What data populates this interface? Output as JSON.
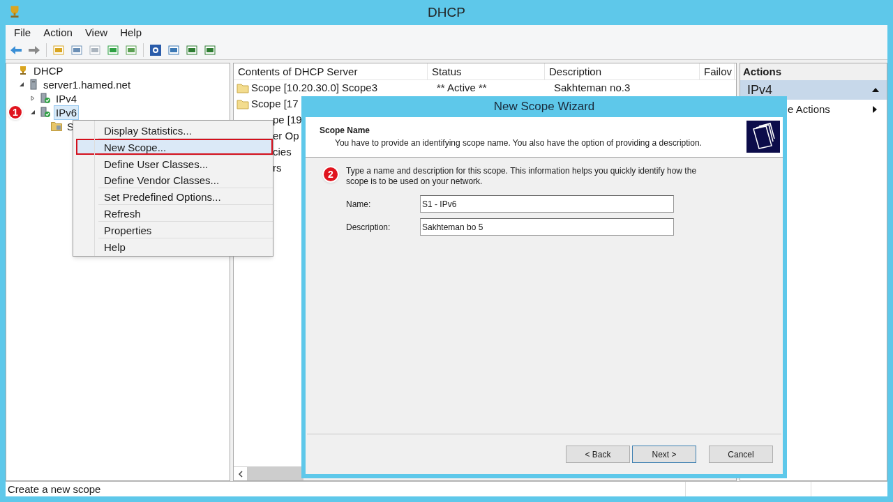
{
  "window": {
    "title": "DHCP"
  },
  "menu": [
    "File",
    "Action",
    "View",
    "Help"
  ],
  "tree": [
    {
      "label": "DHCP",
      "kind": "root",
      "children": [
        {
          "label": "server1.hamed.net",
          "kind": "server",
          "expanded": true,
          "selected": false,
          "children": [
            {
              "label": "IPv4",
              "kind": "protocol",
              "expanded": false,
              "selected": false
            },
            {
              "label": "IPv6",
              "kind": "protocol",
              "expanded": true,
              "selected": true,
              "marker": "1",
              "children": [
                {
                  "label": "S",
                  "kind": "folder",
                  "selected": false
                }
              ]
            }
          ]
        }
      ]
    }
  ],
  "content": {
    "columns": [
      "Contents of DHCP Server",
      "Status",
      "Description",
      "Failov"
    ],
    "rows": [
      {
        "kind": "full",
        "cells": [
          "Scope [10.20.30.0] Scope3",
          "** Active **",
          "Sakhteman no.3"
        ]
      },
      {
        "kind": "full",
        "cells": [
          "Scope [17"
        ]
      },
      {
        "kind": "covered",
        "cells": [
          "pe [19"
        ]
      },
      {
        "kind": "covered",
        "cells": [
          "er Op"
        ]
      },
      {
        "kind": "covered",
        "cells": [
          "cies"
        ]
      },
      {
        "kind": "covered",
        "cells": [
          "rs"
        ]
      }
    ]
  },
  "context_menu": {
    "groups": [
      [
        {
          "label": "Display Statistics...",
          "selected": false
        }
      ],
      [
        {
          "label": "New Scope...",
          "selected": true
        }
      ],
      [
        {
          "label": "Define User Classes...",
          "selected": false
        },
        {
          "label": "Define Vendor Classes...",
          "selected": false
        }
      ],
      [
        {
          "label": "Set Predefined Options...",
          "selected": false
        }
      ],
      [
        {
          "label": "Refresh",
          "selected": false
        }
      ],
      [
        {
          "label": "Properties",
          "selected": false
        }
      ],
      [
        {
          "label": "Help",
          "selected": false
        }
      ]
    ]
  },
  "actions": {
    "title": "Actions",
    "section": {
      "label": "IPv4",
      "expanded": true
    },
    "items": [
      {
        "label": "e Actions"
      }
    ]
  },
  "wizard": {
    "title": "New Scope Wizard",
    "header_title": "Scope Name",
    "header_subtitle": "You have to provide an identifying scope name. You also have the option of providing a description.",
    "marker": "2",
    "instructions": "Type a name and description for this scope. This information helps you quickly identify how the scope is to be used on your network.",
    "fields": [
      {
        "label": "Name:",
        "value": "S1 - IPv6"
      },
      {
        "label": "Description:",
        "value": "Sakhteman bo 5"
      }
    ],
    "buttons": [
      {
        "label": "< Back",
        "default": false
      },
      {
        "label": "Next >",
        "default": true
      },
      {
        "label": "Cancel",
        "default": false
      }
    ]
  },
  "status_bar": "Create a new scope"
}
